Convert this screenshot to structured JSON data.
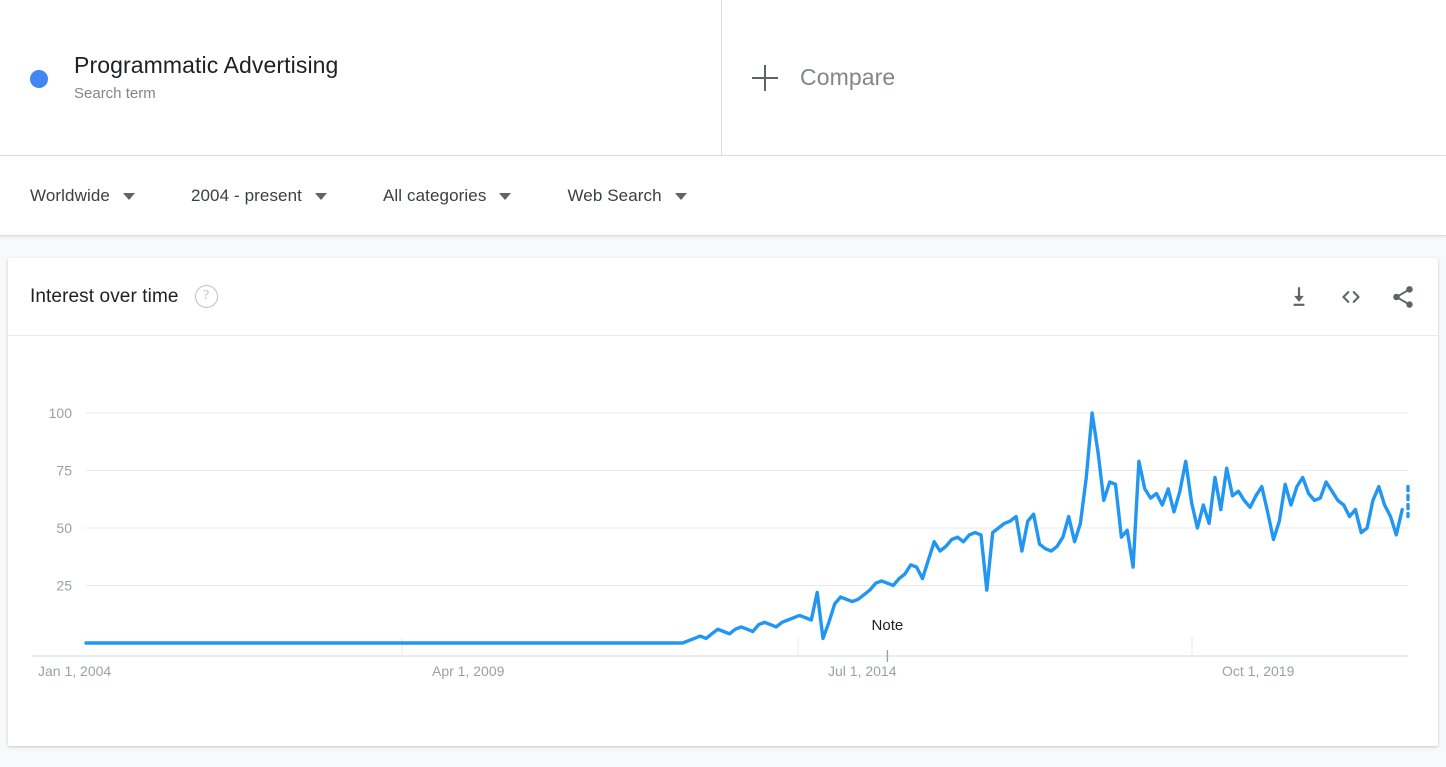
{
  "search_bar": {
    "term": {
      "label": "Programmatic Advertising",
      "type": "Search term",
      "color": "#4285f4"
    },
    "compare": {
      "label": "Compare",
      "icon": "plus-icon"
    }
  },
  "filters": [
    {
      "label": "Worldwide",
      "name": "location"
    },
    {
      "label": "2004 - present",
      "name": "time-range"
    },
    {
      "label": "All categories",
      "name": "category"
    },
    {
      "label": "Web Search",
      "name": "search-type"
    }
  ],
  "card": {
    "title": "Interest over time",
    "help": "?",
    "actions": [
      {
        "name": "download-icon",
        "label": "Download"
      },
      {
        "name": "embed-icon",
        "label": "Embed"
      },
      {
        "name": "share-icon",
        "label": "Share"
      }
    ]
  },
  "chart_data": {
    "type": "line",
    "title": "Interest over time",
    "xlabel": "",
    "ylabel": "",
    "ylim": [
      0,
      100
    ],
    "grid": true,
    "legend": false,
    "line_color": "#2196f3",
    "ytick_labels": [
      "100",
      "75",
      "50",
      "25"
    ],
    "ytick_values": [
      100,
      75,
      50,
      25
    ],
    "xtick_labels": [
      "Jan 1, 2004",
      "Apr 1, 2009",
      "Jul 1, 2014",
      "Oct 1, 2019"
    ],
    "xtick_values": [
      0,
      63,
      126,
      189
    ],
    "annotation": {
      "label": "Note",
      "x_index": 137
    },
    "partial_data_dashed_tail": true,
    "series": [
      {
        "name": "Programmatic Advertising",
        "values": [
          0,
          0,
          0,
          0,
          0,
          0,
          0,
          0,
          0,
          0,
          0,
          0,
          0,
          0,
          0,
          0,
          0,
          0,
          0,
          0,
          0,
          0,
          0,
          0,
          0,
          0,
          0,
          0,
          0,
          0,
          0,
          0,
          0,
          0,
          0,
          0,
          0,
          0,
          0,
          0,
          0,
          0,
          0,
          0,
          0,
          0,
          0,
          0,
          0,
          0,
          0,
          0,
          0,
          0,
          0,
          0,
          0,
          0,
          0,
          0,
          0,
          0,
          0,
          0,
          0,
          0,
          0,
          0,
          0,
          0,
          0,
          0,
          0,
          0,
          0,
          0,
          0,
          0,
          0,
          0,
          0,
          0,
          0,
          0,
          0,
          0,
          0,
          0,
          0,
          0,
          0,
          0,
          0,
          0,
          0,
          0,
          0,
          0,
          0,
          0,
          0,
          0,
          0,
          1,
          2,
          3,
          2,
          4,
          6,
          5,
          4,
          6,
          7,
          6,
          5,
          8,
          9,
          8,
          7,
          9,
          10,
          11,
          12,
          11,
          10,
          22,
          2,
          9,
          17,
          20,
          19,
          18,
          19,
          21,
          23,
          26,
          27,
          26,
          25,
          28,
          30,
          34,
          33,
          28,
          36,
          44,
          40,
          42,
          45,
          46,
          44,
          47,
          48,
          47,
          23,
          48,
          50,
          52,
          53,
          55,
          40,
          53,
          56,
          43,
          41,
          40,
          42,
          46,
          55,
          44,
          52,
          72,
          100,
          83,
          62,
          70,
          69,
          46,
          49,
          33,
          79,
          67,
          63,
          65,
          60,
          67,
          57,
          66,
          79,
          61,
          50,
          60,
          52,
          72,
          58,
          76,
          64,
          66,
          62,
          59,
          64,
          68,
          57,
          45,
          53,
          69,
          60,
          68,
          72,
          65,
          62,
          63,
          70,
          66,
          62,
          60,
          55,
          58,
          48,
          50,
          62,
          68,
          60,
          55,
          47,
          58,
          55
        ]
      }
    ]
  }
}
